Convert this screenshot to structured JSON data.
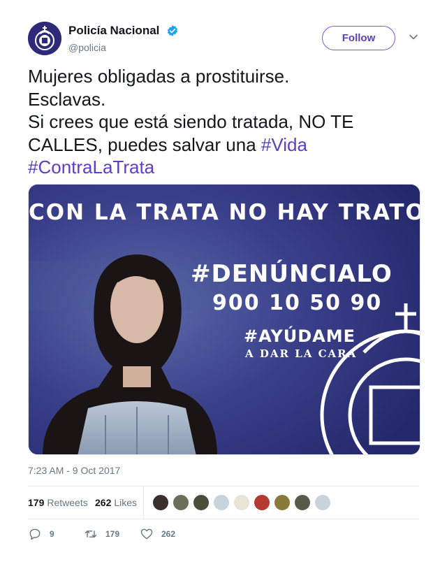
{
  "account": {
    "display_name": "Policía Nacional",
    "handle": "@policia",
    "verified_icon": "verified-badge-icon",
    "brand_color": "#2d2a7a"
  },
  "follow_button": {
    "label": "Follow",
    "color": "#5b3fc4"
  },
  "more_menu": {
    "icon": "chevron-down-icon"
  },
  "tweet": {
    "lines": [
      {
        "text": "Mujeres obligadas a prostituirse."
      },
      {
        "text": "Esclavas."
      },
      {
        "text": "Si crees que está siendo tratada, NO TE"
      },
      {
        "text": "CALLES, puedes salvar una ",
        "hashtag": "#Vida"
      },
      {
        "hashtag": "#ContraLaTrata"
      }
    ]
  },
  "media": {
    "headline": "CON LA TRATA NO HAY TRATO",
    "hashtag": "#DENÚNCIALO",
    "phone": "900 10 50 90",
    "help_hashtag": "#AYÚDAME",
    "sub": "A DAR LA CARA",
    "emblem_icon": "police-emblem-icon",
    "background_color": "#2c2f78"
  },
  "timestamp": "7:23 AM - 9 Oct 2017",
  "stats": {
    "retweets_count": "179",
    "retweets_label": "Retweets",
    "likes_count": "262",
    "likes_label": "Likes",
    "likers_avatars": [
      "avatar-1",
      "avatar-2",
      "avatar-3",
      "avatar-4",
      "avatar-5",
      "avatar-6",
      "avatar-7",
      "avatar-8",
      "avatar-9"
    ]
  },
  "actions": {
    "reply": {
      "icon": "reply-icon",
      "count": "9"
    },
    "retweet": {
      "icon": "retweet-icon",
      "count": "179"
    },
    "like": {
      "icon": "heart-icon",
      "count": "262"
    }
  }
}
